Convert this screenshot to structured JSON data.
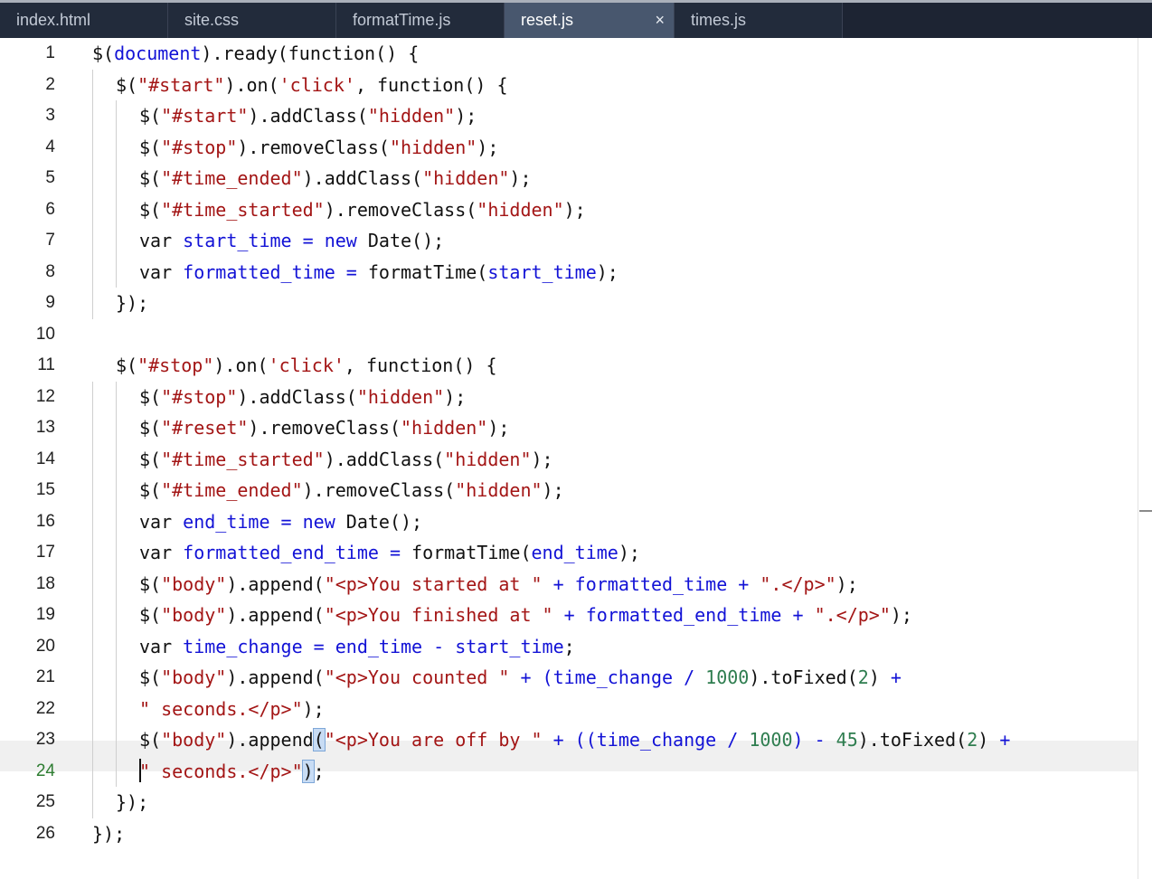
{
  "tabs": [
    {
      "label": "index.html",
      "active": false
    },
    {
      "label": "site.css",
      "active": false
    },
    {
      "label": "formatTime.js",
      "active": false
    },
    {
      "label": "reset.js",
      "active": true
    },
    {
      "label": "times.js",
      "active": false
    }
  ],
  "close_glyph": "×",
  "current_line": 24,
  "lines": [
    {
      "n": "1"
    },
    {
      "n": "2"
    },
    {
      "n": "3"
    },
    {
      "n": "4"
    },
    {
      "n": "5"
    },
    {
      "n": "6"
    },
    {
      "n": "7"
    },
    {
      "n": "8"
    },
    {
      "n": "9"
    },
    {
      "n": "10"
    },
    {
      "n": "11"
    },
    {
      "n": "12"
    },
    {
      "n": "13"
    },
    {
      "n": "14"
    },
    {
      "n": "15"
    },
    {
      "n": "16"
    },
    {
      "n": "17"
    },
    {
      "n": "18"
    },
    {
      "n": "19"
    },
    {
      "n": "20"
    },
    {
      "n": "21"
    },
    {
      "n": "22"
    },
    {
      "n": "23"
    },
    {
      "n": "24"
    },
    {
      "n": "25"
    },
    {
      "n": "26"
    }
  ],
  "code": {
    "l1": [
      "$(",
      "document",
      ").ready(function() {"
    ],
    "l2": [
      "$(",
      "\"#start\"",
      ").on(",
      "'click'",
      ", function() {"
    ],
    "l3": [
      "$(",
      "\"#start\"",
      ").addClass(",
      "\"hidden\"",
      ");"
    ],
    "l4": [
      "$(",
      "\"#stop\"",
      ").removeClass(",
      "\"hidden\"",
      ");"
    ],
    "l5": [
      "$(",
      "\"#time_ended\"",
      ").addClass(",
      "\"hidden\"",
      ");"
    ],
    "l6": [
      "$(",
      "\"#time_started\"",
      ").removeClass(",
      "\"hidden\"",
      ");"
    ],
    "l7": [
      "var ",
      "start_time",
      " = ",
      "new",
      " Date();"
    ],
    "l8": [
      "var ",
      "formatted_time",
      " = ",
      "formatTime(",
      "start_time",
      ");"
    ],
    "l9": [
      "});"
    ],
    "l11": [
      "$(",
      "\"#stop\"",
      ").on(",
      "'click'",
      ", function() {"
    ],
    "l12": [
      "$(",
      "\"#stop\"",
      ").addClass(",
      "\"hidden\"",
      ");"
    ],
    "l13": [
      "$(",
      "\"#reset\"",
      ").removeClass(",
      "\"hidden\"",
      ");"
    ],
    "l14": [
      "$(",
      "\"#time_started\"",
      ").addClass(",
      "\"hidden\"",
      ");"
    ],
    "l15": [
      "$(",
      "\"#time_ended\"",
      ").removeClass(",
      "\"hidden\"",
      ");"
    ],
    "l16": [
      "var ",
      "end_time",
      " = ",
      "new",
      " Date();"
    ],
    "l17": [
      "var ",
      "formatted_end_time",
      " = ",
      "formatTime(",
      "end_time",
      ");"
    ],
    "l18": [
      "$(",
      "\"body\"",
      ").append(",
      "\"<p>You started at \"",
      " + ",
      "formatted_time",
      " + ",
      "\".</p>\"",
      ");"
    ],
    "l19": [
      "$(",
      "\"body\"",
      ").append(",
      "\"<p>You finished at \"",
      " + ",
      "formatted_end_time",
      " + ",
      "\".</p>\"",
      ");"
    ],
    "l20": [
      "var ",
      "time_change",
      " = ",
      "end_time",
      " - ",
      "start_time",
      ";"
    ],
    "l21": [
      "$(",
      "\"body\"",
      ").append(",
      "\"<p>You counted \"",
      " + ",
      "(time_change / ",
      "1000",
      ").toFixed(",
      "2",
      ") ",
      "+"
    ],
    "l22": [
      "\" seconds.</p>\"",
      ");"
    ],
    "l23": [
      "$(",
      "\"body\"",
      ").append",
      "(",
      "\"<p>You are off by \"",
      " + ",
      "((time_change / ",
      "1000",
      ") - ",
      "45",
      ").toFixed(",
      "2",
      ") ",
      "+"
    ],
    "l24": [
      "\" seconds.</p>\"",
      ")",
      ";"
    ],
    "l25": [
      "});"
    ],
    "l26": [
      "});"
    ]
  }
}
